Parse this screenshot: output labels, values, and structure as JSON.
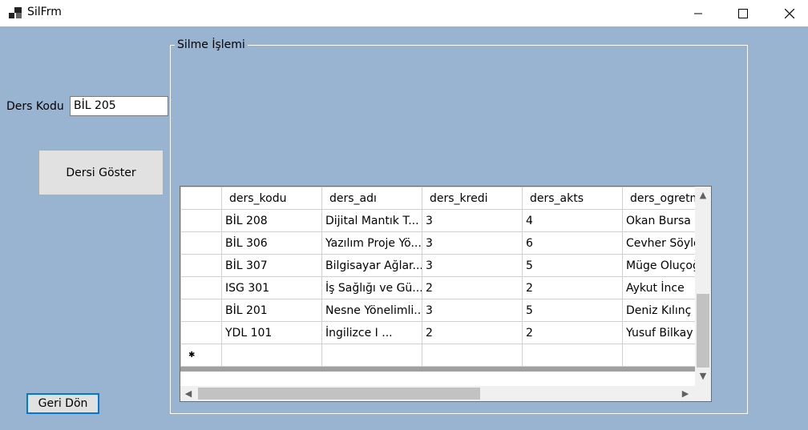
{
  "window": {
    "title": "SilFrm",
    "minimize_icon": "minimize-icon",
    "maximize_icon": "maximize-icon",
    "close_icon": "close-icon"
  },
  "form": {
    "ders_kodu_label": "Ders Kodu",
    "ders_kodu_value": "BİL 205",
    "show_button": "Dersi Göster",
    "back_button": "Geri Dön",
    "group_title": "Silme İşlemi"
  },
  "grid": {
    "columns": [
      "ders_kodu",
      "ders_adı",
      "ders_kredi",
      "ders_akts",
      "ders_ogretm"
    ],
    "rows": [
      [
        "BİL 208",
        "Dijital Mantık T...",
        "3",
        "4",
        "Okan Bursa"
      ],
      [
        "BİL 306",
        "Yazılım Proje Yö...",
        "3",
        "6",
        "Cevher Söyle"
      ],
      [
        "BİL 307",
        "Bilgisayar Ağlar...",
        "3",
        "5",
        "Müge Oluçoğ"
      ],
      [
        "ISG 301",
        "İş Sağlığı ve Gü...",
        "2",
        "2",
        "Aykut İnce"
      ],
      [
        "BİL 201",
        "Nesne Yönelimli...",
        "3",
        "5",
        "Deniz Kılınç"
      ],
      [
        "YDL 101",
        "İngilizce I          ...",
        "2",
        "2",
        "Yusuf Bilkay"
      ]
    ],
    "new_row_marker": "✱"
  },
  "scrollbars": {
    "up": "▲",
    "down": "▼",
    "left": "◀",
    "right": "▶"
  }
}
